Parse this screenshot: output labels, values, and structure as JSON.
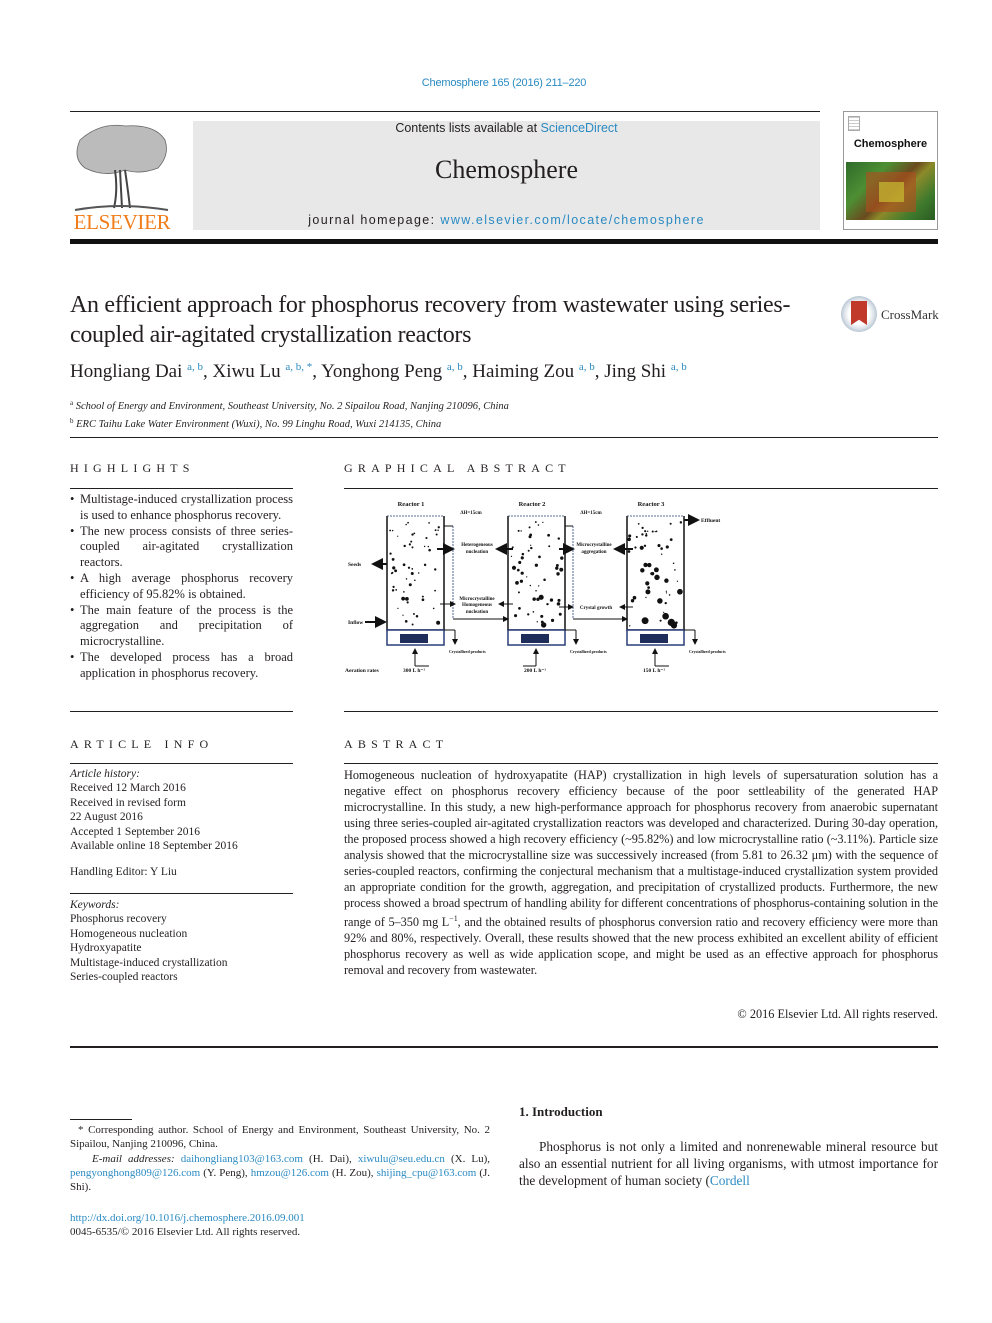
{
  "header": {
    "citation": "Chemosphere 165 (2016) 211–220",
    "contents_prefix": "Contents lists available at ",
    "contents_link": "ScienceDirect",
    "journal_name": "Chemosphere",
    "homepage_prefix": "journal homepage: ",
    "homepage_url": "www.elsevier.com/locate/chemosphere",
    "publisher_logo": "ELSEVIER",
    "cover_title": "Chemosphere",
    "crossmark_label": "CrossMark"
  },
  "article": {
    "title": "An efficient approach for phosphorus recovery from wastewater using series-coupled air-agitated crystallization reactors",
    "authors": [
      {
        "name": "Hongliang Dai",
        "sup": "a, b"
      },
      {
        "name": "Xiwu Lu",
        "sup": "a, b, *"
      },
      {
        "name": "Yonghong Peng",
        "sup": "a, b"
      },
      {
        "name": "Haiming Zou",
        "sup": "a, b"
      },
      {
        "name": "Jing Shi",
        "sup": "a, b"
      }
    ],
    "affiliations": [
      {
        "mark": "a",
        "text": "School of Energy and Environment, Southeast University, No. 2 Sipailou Road, Nanjing 210096, China"
      },
      {
        "mark": "b",
        "text": "ERC Taihu Lake Water Environment (Wuxi), No. 99 Linghu Road, Wuxi 214135, China"
      }
    ]
  },
  "highlights": {
    "heading": "HIGHLIGHTS",
    "items": [
      "Multistage-induced crystallization process is used to enhance phosphorus recovery.",
      "The new process consists of three series-coupled air-agitated crystallization reactors.",
      "A high average phosphorus recovery efficiency of 95.82% is obtained.",
      "The main feature of the process is the aggregation and precipitation of microcrystalline.",
      "The developed process has a broad application in phosphorus recovery."
    ]
  },
  "graphical_abstract": {
    "heading": "GRAPHICAL ABSTRACT",
    "reactors": [
      "Reactor 1",
      "Reactor 2",
      "Reactor 3"
    ],
    "delta_h": "ΔH=15cm",
    "labels": {
      "seeds": "Seeds",
      "inflow": "Inflow",
      "effluent": "Effluent",
      "hetero": [
        "Heterogeneous",
        "nucleation"
      ],
      "homo": [
        "Microcrystalline",
        "Homogeneous",
        "nucleation"
      ],
      "aggregation": [
        "Microcrystalline",
        "aggregation"
      ],
      "growth": "Crystal growth",
      "products": "Crystallized products",
      "aeration": "Aeration rates"
    },
    "aeration_rates": [
      "300 L h⁻¹",
      "200 L h⁻¹",
      "150 L h⁻¹"
    ]
  },
  "article_info": {
    "heading": "ARTICLE INFO",
    "history_label": "Article history:",
    "history": [
      "Received 12 March 2016",
      "Received in revised form",
      "22 August 2016",
      "Accepted 1 September 2016",
      "Available online 18 September 2016"
    ],
    "handling_editor": "Handling Editor: Y Liu",
    "keywords_label": "Keywords:",
    "keywords": [
      "Phosphorus recovery",
      "Homogeneous nucleation",
      "Hydroxyapatite",
      "Multistage-induced crystallization",
      "Series-coupled reactors"
    ]
  },
  "abstract": {
    "heading": "ABSTRACT",
    "text_before_sup": "Homogeneous nucleation of hydroxyapatite (HAP) crystallization in high levels of supersaturation solution has a negative effect on phosphorus recovery efficiency because of the poor settleability of the generated HAP microcrystalline. In this study, a new high-performance approach for phosphorus recovery from anaerobic supernatant using three series-coupled air-agitated crystallization reactors was developed and characterized. During 30-day operation, the proposed process showed a high recovery efficiency (~95.82%) and low microcrystalline ratio (~3.11%). Particle size analysis showed that the microcrystalline size was successively increased (from 5.81 to 26.32 μm) with the sequence of series-coupled reactors, confirming the conjectural mechanism that a multistage-induced crystallization system provided an appropriate condition for the growth, aggregation, and precipitation of crystallized products. Furthermore, the new process showed a broad spectrum of handling ability for different concentrations of phosphorus-containing solution in the range of 5–350 mg L",
    "sup": "−1",
    "text_after_sup": ", and the obtained results of phosphorus conversion ratio and recovery efficiency were more than 92% and 80%, respectively. Overall, these results showed that the new process exhibited an excellent ability of efficient phosphorus recovery as well as wide application scope, and might be used as an effective approach for phosphorus removal and recovery from wastewater.",
    "copyright": "© 2016 Elsevier Ltd. All rights reserved."
  },
  "footnotes": {
    "corresponding": "* Corresponding author. School of Energy and Environment, Southeast University, No. 2 Sipailou, Nanjing 210096, China.",
    "email_label": "E-mail addresses:",
    "emails": [
      {
        "email": "daihongliang103@163.com",
        "who": "(H. Dai),"
      },
      {
        "email": "xiwulu@seu.edu.cn",
        "who": "(X. Lu),"
      },
      {
        "email": "pengyonghong809@126.com",
        "who": "(Y. Peng),"
      },
      {
        "email": "hmzou@126.com",
        "who": "(H. Zou),"
      },
      {
        "email": "shijing_cpu@163.com",
        "who": "(J. Shi)."
      }
    ],
    "doi": "http://dx.doi.org/10.1016/j.chemosphere.2016.09.001",
    "issn": "0045-6535/© 2016 Elsevier Ltd. All rights reserved."
  },
  "introduction": {
    "heading": "1.  Introduction",
    "text": "Phosphorus is not only a limited and nonrenewable mineral resource but also an essential nutrient for all living organisms, with utmost importance for the development of human society (",
    "link": "Cordell"
  }
}
